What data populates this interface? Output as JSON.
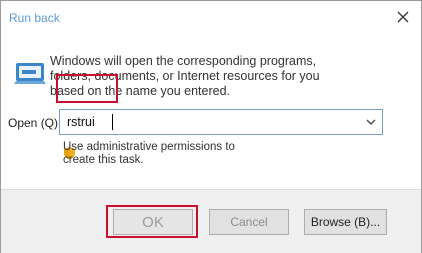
{
  "window": {
    "title": "Run back",
    "close_icon": "close-icon"
  },
  "body": {
    "description": "Windows will open the corresponding programs, folders, documents, or Internet resources for you based on the name you entered.",
    "open_label": "Open (Q)",
    "input_value": "rstrui",
    "admin_line1": "Use administrative permissions to",
    "admin_line2": "create this task."
  },
  "buttons": {
    "ok": "OK",
    "cancel": "Cancel",
    "browse": "Browse (B)..."
  },
  "colors": {
    "highlight": "#c8102e",
    "title_text": "#5b9bd5"
  }
}
